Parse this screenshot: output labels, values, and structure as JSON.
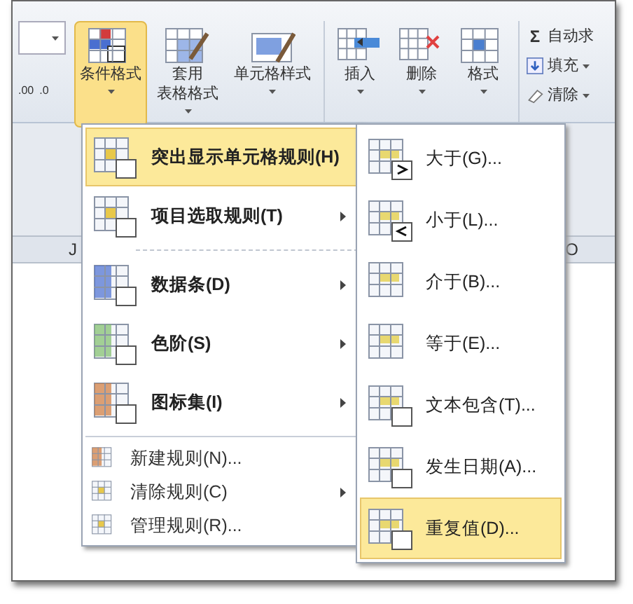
{
  "ribbon": {
    "decimal_buttons": [
      {
        "label": ".00"
      },
      {
        "label": ".0"
      }
    ],
    "style_buttons": [
      {
        "lines": [
          "条件格式"
        ],
        "selected": true,
        "dropdown": true
      },
      {
        "lines": [
          "套用",
          "表格格式"
        ],
        "selected": false,
        "dropdown": true
      },
      {
        "lines": [
          "单元格样式"
        ],
        "selected": false,
        "dropdown": true
      }
    ],
    "cell_buttons": [
      {
        "lines": [
          "插入"
        ],
        "dropdown": true
      },
      {
        "lines": [
          "删除"
        ],
        "dropdown": true
      },
      {
        "lines": [
          "格式"
        ],
        "dropdown": true
      }
    ],
    "editing_buttons": [
      {
        "symbol": "Σ",
        "label": "自动求",
        "dropdown": false
      },
      {
        "label": "填充",
        "dropdown": true
      },
      {
        "label": "清除",
        "dropdown": true
      }
    ]
  },
  "sheet": {
    "column_headers": [
      "J",
      "O"
    ]
  },
  "main_menu": {
    "sections": [
      {
        "kind": "first",
        "items": [
          {
            "kind": "large",
            "label": "突出显示单元格规则(H)",
            "selected": true,
            "submenu": true
          },
          {
            "kind": "large",
            "label": "项目选取规则(T)",
            "selected": false,
            "submenu": true
          }
        ]
      },
      {
        "kind": "dotted",
        "items": [
          {
            "kind": "large",
            "label": "数据条(D)",
            "selected": false,
            "submenu": true
          },
          {
            "kind": "large",
            "label": "色阶(S)",
            "selected": false,
            "submenu": true
          },
          {
            "kind": "large",
            "label": "图标集(I)",
            "selected": false,
            "submenu": true
          }
        ]
      },
      {
        "kind": "solid",
        "items": [
          {
            "kind": "small",
            "label": "新建规则(N)...",
            "selected": false,
            "submenu": false
          },
          {
            "kind": "small",
            "label": "清除规则(C)",
            "selected": false,
            "submenu": true
          },
          {
            "kind": "small",
            "label": "管理规则(R)...",
            "selected": false,
            "submenu": false
          }
        ]
      }
    ]
  },
  "submenu": {
    "items": [
      {
        "label": "大于(G)...",
        "selected": false
      },
      {
        "label": "小于(L)...",
        "selected": false
      },
      {
        "label": "介于(B)...",
        "selected": false
      },
      {
        "label": "等于(E)...",
        "selected": false
      },
      {
        "label": "文本包含(T)...",
        "selected": false
      },
      {
        "label": "发生日期(A)...",
        "selected": false
      },
      {
        "label": "重复值(D)...",
        "selected": true
      }
    ]
  }
}
